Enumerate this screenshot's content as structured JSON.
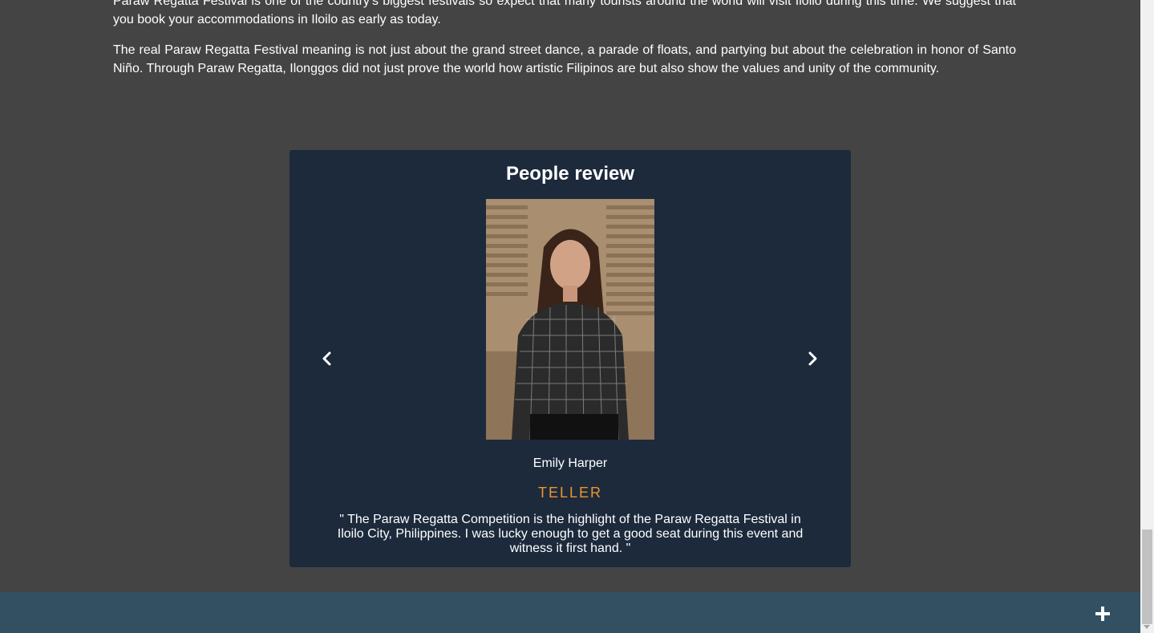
{
  "article": {
    "paragraph1": "Paraw Regatta Festival is one of the country's biggest festivals so expect that many tourists around the world will visit Iloilo during this time. We suggest that you book your accommodations in Iloilo as early as today.",
    "paragraph2": "The real Paraw Regatta Festival meaning is not just about the grand street dance, a parade of floats, and partying but about the celebration in honor of Santo Niño. Through Paraw Regatta, Ilonggos did not just prove the world how artistic Filipinos are but also show the values and unity of the community."
  },
  "review": {
    "title": "People review",
    "reviewer_name": "Emily Harper",
    "reviewer_role": "TELLER",
    "quote": "\" The Paraw Regatta Competition is the highlight of the Paraw Regatta Festival in Iloilo City, Philippines. I was lucky enough to get a good seat during this event and witness it first hand. \"",
    "prev_icon": "chevron-left-icon",
    "next_icon": "chevron-right-icon"
  },
  "footer": {
    "action_icon": "plus-icon"
  },
  "colors": {
    "page_background": "#444444",
    "card_background": "#1c2a3c",
    "accent": "#f0952b",
    "footer_background": "#325062"
  }
}
